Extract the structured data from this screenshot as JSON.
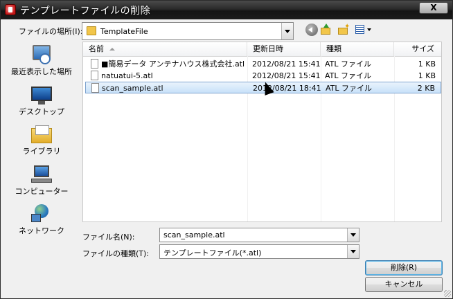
{
  "window": {
    "title": "テンプレートファイルの削除",
    "close_label": "X"
  },
  "lookin": {
    "label": "ファイルの場所(I):",
    "value": "TemplateFile"
  },
  "toolbar": {
    "back": "back-icon",
    "up": "up-folder-icon",
    "new_folder": "new-folder-icon",
    "views": "views-menu-icon"
  },
  "places": [
    {
      "label": "最近表示した場所",
      "icon": "recent-places-icon"
    },
    {
      "label": "デスクトップ",
      "icon": "desktop-icon"
    },
    {
      "label": "ライブラリ",
      "icon": "library-icon"
    },
    {
      "label": "コンピューター",
      "icon": "computer-icon"
    },
    {
      "label": "ネットワーク",
      "icon": "network-icon"
    }
  ],
  "columns": [
    "名前",
    "更新日時",
    "種類",
    "サイズ"
  ],
  "files": [
    {
      "name": "■簡易データ アンテナハウス株式会社.atl",
      "date": "2012/08/21 15:41",
      "type": "ATL ファイル",
      "size": "1 KB",
      "selected": false
    },
    {
      "name": "natuatui-5.atl",
      "date": "2012/08/21 15:41",
      "type": "ATL ファイル",
      "size": "1 KB",
      "selected": false
    },
    {
      "name": "scan_sample.atl",
      "date": "2012/08/21 18:41",
      "type": "ATL ファイル",
      "size": "2 KB",
      "selected": true
    }
  ],
  "filename": {
    "label": "ファイル名(N):",
    "value": "scan_sample.atl"
  },
  "filetype": {
    "label": "ファイルの種類(T):",
    "value": "テンプレートファイル(*.atl)"
  },
  "buttons": {
    "delete": "削除(R)",
    "cancel": "キャンセル"
  },
  "colors": {
    "title_bar": "#1c1c1c",
    "selection": "#c8e1f9",
    "selection_border": "#7da2ce"
  }
}
